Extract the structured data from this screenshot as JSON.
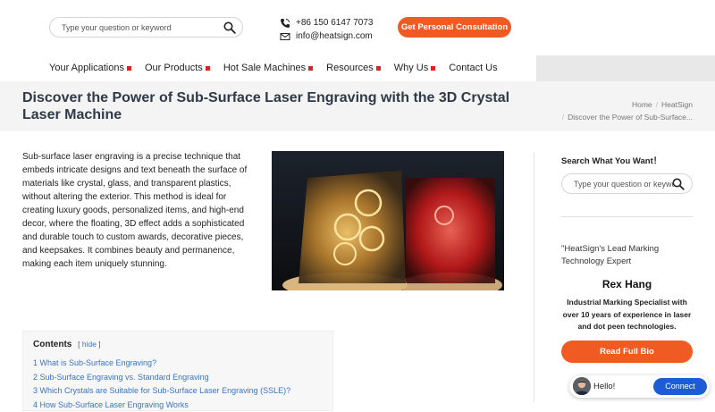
{
  "header": {
    "search_placeholder": "Type your question or keyword",
    "phone": "+86 150 6147 7073",
    "email": "info@heatsign.com",
    "cta_label": "Get Personal Consultation"
  },
  "nav": {
    "items": [
      {
        "label": "Your Applications"
      },
      {
        "label": "Our Products"
      },
      {
        "label": "Hot Sale Machines"
      },
      {
        "label": "Resources"
      },
      {
        "label": "Why Us"
      },
      {
        "label": "Contact Us"
      }
    ]
  },
  "page": {
    "title": "Discover the Power of Sub-Surface Laser Engraving with the 3D Crystal Laser Machine",
    "breadcrumb": [
      "Home",
      "HeatSign",
      "Discover the Power of Sub-Surface..."
    ]
  },
  "content": {
    "intro": "Sub-surface laser engraving is a precise technique that embeds intricate designs and text beneath the surface of materials like crystal, glass, and transparent plastics, without altering the exterior. This method is ideal for creating luxury goods, personalized items, and high-end decor, where the floating, 3D effect adds a sophisticated and durable touch to custom awards, decorative pieces, and keepsakes. It combines beauty and permanence, making each item uniquely stunning."
  },
  "toc": {
    "title": "Contents",
    "hide_label": "hide",
    "items": [
      "1 What is Sub-Surface Engraving?",
      "2 Sub-Surface Engraving vs. Standard Engraving",
      "3 Which Crystals are Suitable for Sub-Surface Laser Engraving (SSLE)?",
      "4 How Sub-Surface Laser Engraving Works"
    ]
  },
  "sidebar": {
    "search_title": "Search What You Want！",
    "search_placeholder": "Type your question or keyword",
    "quote": "\"HeatSign's Lead Marking Technology Expert",
    "author_name": "Rex Hang",
    "author_role": "Industrial Marking Specialist with over 10 years of experience in laser and dot peen technologies.",
    "bio_button": "Read Full Bio"
  },
  "chat": {
    "greeting": "Hello!",
    "connect_label": "Connect"
  },
  "colors": {
    "accent": "#f05a23",
    "link": "#3a73c4",
    "title": "#2f3a48",
    "chat_button": "#1e5cd6"
  }
}
